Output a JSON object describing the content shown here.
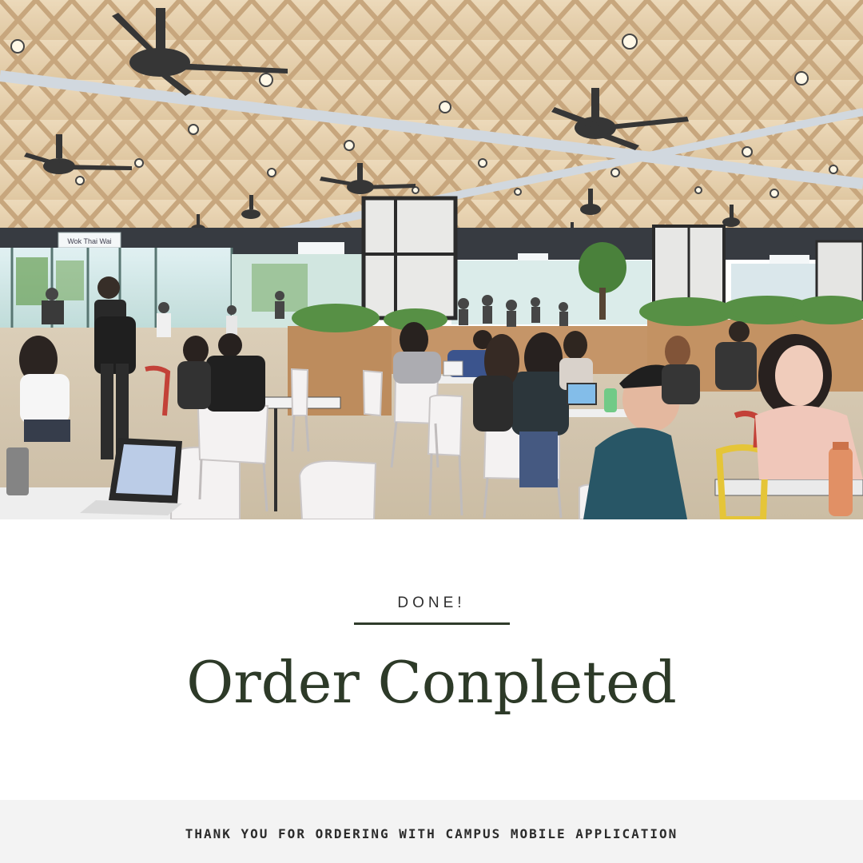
{
  "hero": {
    "photo": "campus-cafeteria-photo",
    "sign_left": "Wok Thai Wai"
  },
  "confirmation": {
    "eyebrow": "DONE!",
    "headline": "Order Conpleted"
  },
  "footer": {
    "message": "THANK YOU FOR ORDERING WITH CAMPUS MOBILE APPLICATION"
  },
  "colors": {
    "headline": "#2d3a28",
    "rule": "#2f3b2a",
    "footer_bg": "#f3f3f3"
  }
}
